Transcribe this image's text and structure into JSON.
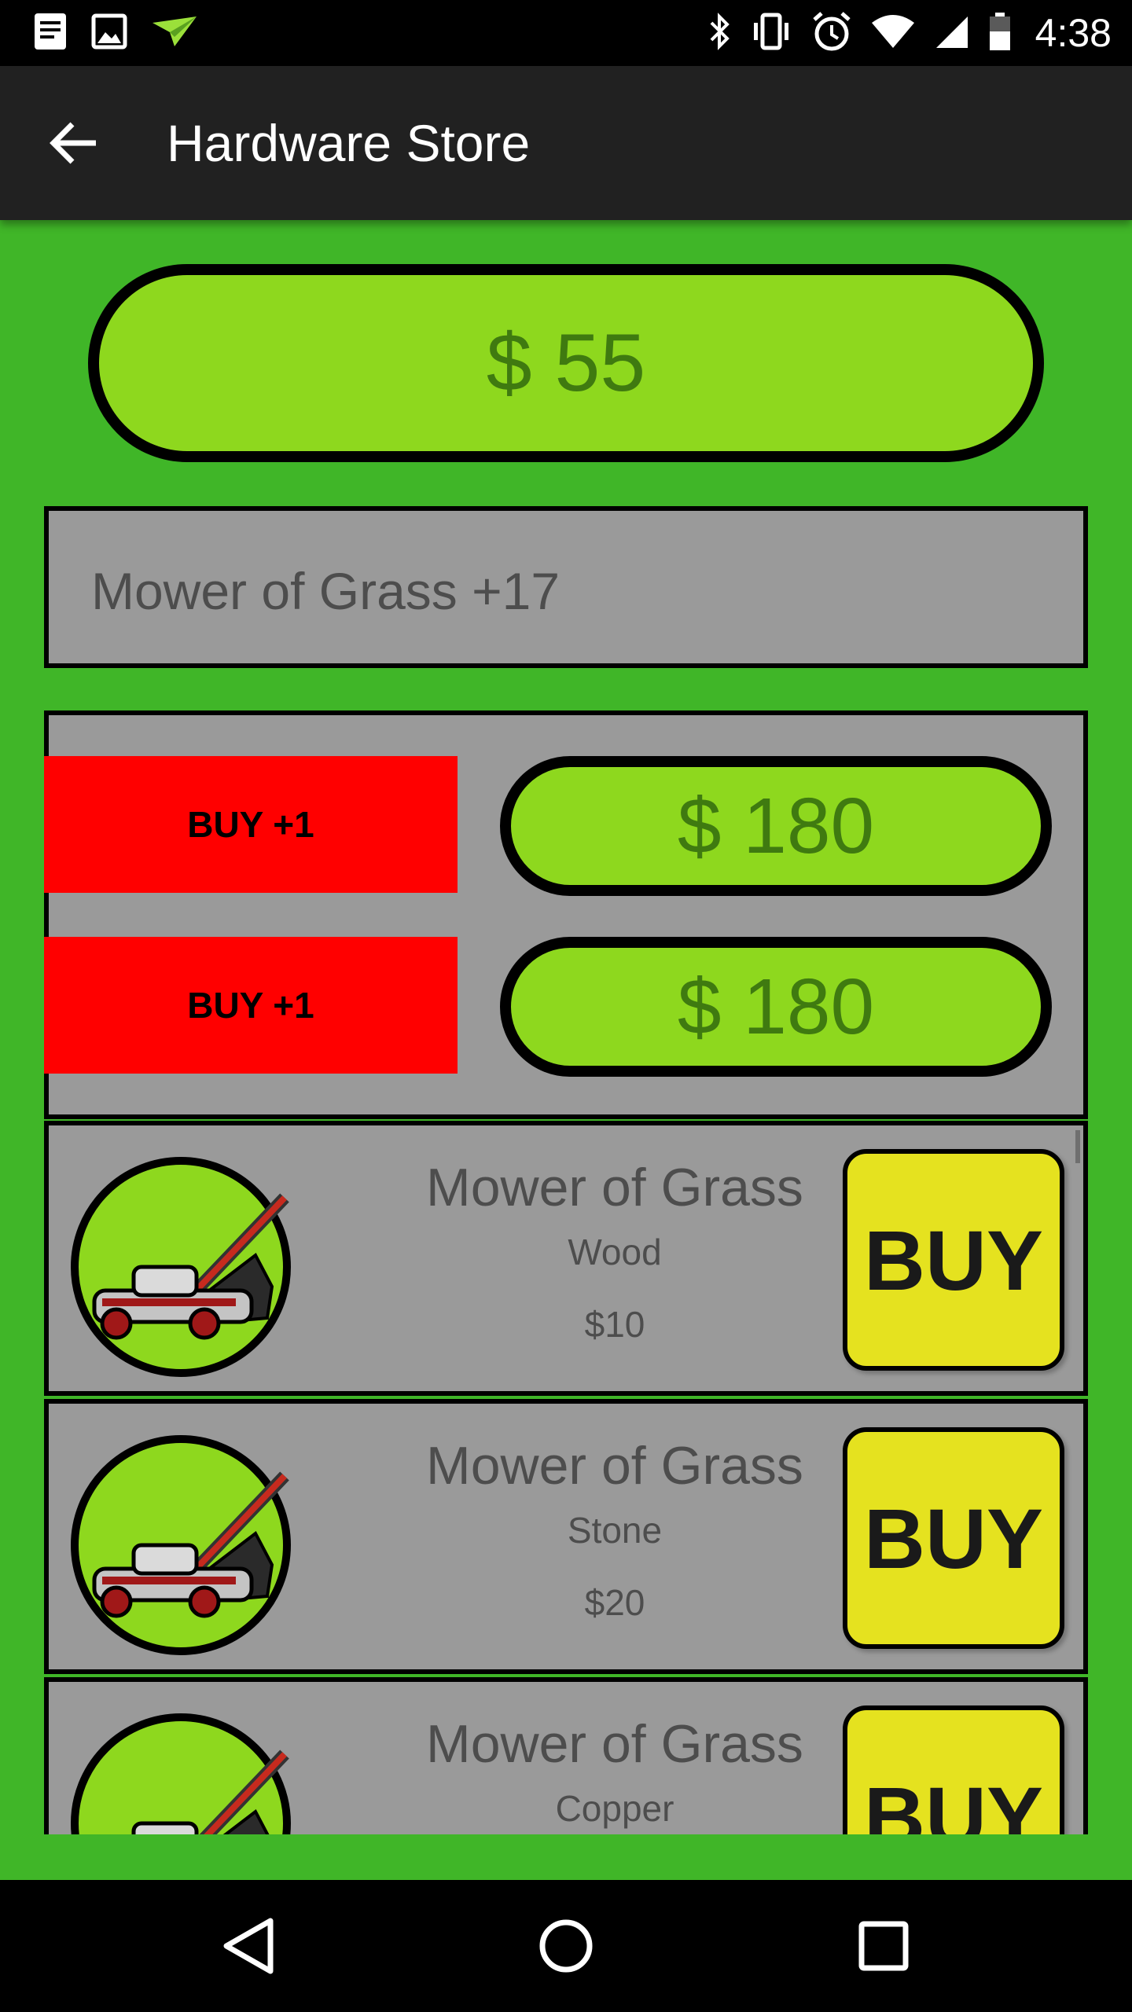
{
  "status_bar": {
    "time": "4:38",
    "left_icons": [
      "document-icon",
      "image-icon",
      "paper-plane-icon"
    ],
    "right_icons": [
      "bluetooth-icon",
      "vibrate-icon",
      "alarm-icon",
      "wifi-icon",
      "signal-icon",
      "battery-icon"
    ]
  },
  "app_bar": {
    "title": "Hardware Store",
    "back_icon": "arrow-back-icon"
  },
  "money": {
    "label": "$ 55"
  },
  "selected": {
    "text": "Mower of Grass +17"
  },
  "upgrades": [
    {
      "buy_label": "BUY +1",
      "price": "$ 180"
    },
    {
      "buy_label": "BUY +1",
      "price": "$ 180"
    }
  ],
  "shop_items": [
    {
      "name": "Mower of Grass",
      "material": "Wood",
      "price": "$10",
      "buy_label": "BUY",
      "icon": "lawn-mower-icon"
    },
    {
      "name": "Mower of Grass",
      "material": "Stone",
      "price": "$20",
      "buy_label": "BUY",
      "icon": "lawn-mower-icon"
    },
    {
      "name": "Mower of Grass",
      "material": "Copper",
      "price": "",
      "buy_label": "BUY",
      "icon": "lawn-mower-icon"
    }
  ],
  "nav_bar": {
    "icons": [
      "nav-back-icon",
      "nav-home-icon",
      "nav-recents-icon"
    ]
  },
  "colors": {
    "background_green": "#40b628",
    "pill_green": "#8ed81e",
    "pill_text_green": "#3f7a10",
    "panel_gray": "#9a9a9a",
    "buy_red": "#ff0000",
    "buy_yellow": "#e5e21f",
    "app_bar": "#212121"
  }
}
